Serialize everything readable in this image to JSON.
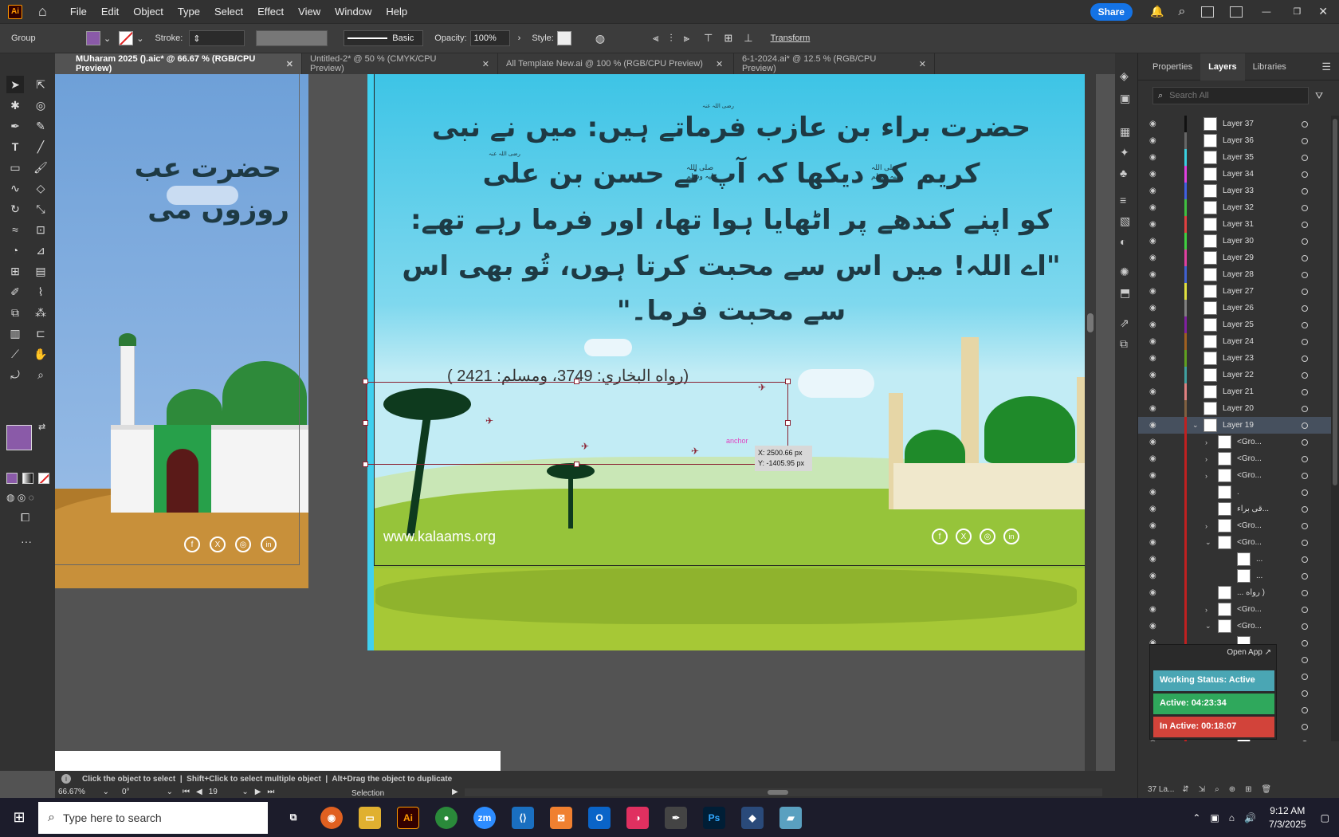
{
  "app": {
    "logo": "Ai",
    "home_icon": "home-icon"
  },
  "menu": [
    "File",
    "Edit",
    "Object",
    "Type",
    "Select",
    "Effect",
    "View",
    "Window",
    "Help"
  ],
  "topright": {
    "share": "Share"
  },
  "control": {
    "selection_label": "Group",
    "fill_color": "#8a5aa8",
    "stroke_label": "Stroke:",
    "brush_label": "Basic",
    "opacity_label": "Opacity:",
    "opacity_value": "100%",
    "style_label": "Style:",
    "transform_label": "Transform"
  },
  "tabs": [
    {
      "label": "MUharam 2025 ().aic* @ 66.67 % (RGB/CPU Preview)",
      "active": true
    },
    {
      "label": "Untitled-2* @ 50 % (CMYK/CPU Preview)",
      "active": false
    },
    {
      "label": "All Template New.ai @ 100 % (RGB/CPU Preview)",
      "active": false
    },
    {
      "label": "6-1-2024.ai* @ 12.5 % (RGB/CPU Preview)",
      "active": false
    }
  ],
  "artwork": {
    "left_lines": [
      "حضرت عب",
      "روزوں می"
    ],
    "main_lines": [
      "حضرت براء بن عازب فرماتے ہیں: میں نے نبی",
      "کریم کو دیکھا کہ آپ نے حسن بن علی",
      "کو اپنے کندھے پر اٹھایا ہوا تھا، اور فرما رہے تھے:",
      "\"اے اللہ! میں اس سے محبت کرتا ہوں، تُو بھی اس",
      "سے محبت فرما۔\""
    ],
    "honorific_1": "رضی اللہ عنہ",
    "honorific_2": "صلی اللہ علیہ وسلم",
    "reference": "(رواه البخاري: 3749، ومسلم: 2421 )",
    "website": "www.kalaams.org",
    "anchor_label": "anchor",
    "coord_x": "X: 2500.66 px",
    "coord_y": "Y: -1405.95 px",
    "social_icons": [
      "facebook-icon",
      "x-icon",
      "instagram-icon",
      "linkedin-icon"
    ]
  },
  "panel": {
    "tabs": [
      "Properties",
      "Layers",
      "Libraries"
    ],
    "active_tab": "Layers",
    "search_placeholder": "Search All",
    "layers": [
      {
        "name": "Layer 37",
        "color": "#111111"
      },
      {
        "name": "Layer 36",
        "color": "#666666"
      },
      {
        "name": "Layer 35",
        "color": "#3ad0e0"
      },
      {
        "name": "Layer 34",
        "color": "#e040e0"
      },
      {
        "name": "Layer 33",
        "color": "#4060e0"
      },
      {
        "name": "Layer 32",
        "color": "#40c040"
      },
      {
        "name": "Layer 31",
        "color": "#e04040"
      },
      {
        "name": "Layer 30",
        "color": "#40d040"
      },
      {
        "name": "Layer 29",
        "color": "#e040a0"
      },
      {
        "name": "Layer 28",
        "color": "#4060d0"
      },
      {
        "name": "Layer 27",
        "color": "#e0e040"
      },
      {
        "name": "Layer 26",
        "color": "#808080"
      },
      {
        "name": "Layer 25",
        "color": "#8020a0"
      },
      {
        "name": "Layer 24",
        "color": "#a06020"
      },
      {
        "name": "Layer 23",
        "color": "#60a020"
      },
      {
        "name": "Layer 22",
        "color": "#40a0a0"
      },
      {
        "name": "Layer 21",
        "color": "#e08080"
      },
      {
        "name": "Layer 20",
        "color": "#806040"
      },
      {
        "name": "Layer 19",
        "color": "#c02020"
      }
    ],
    "sublayers": [
      {
        "name": "<Gro...",
        "indent": 1,
        "chev": "›"
      },
      {
        "name": "<Gro...",
        "indent": 1,
        "chev": "›"
      },
      {
        "name": "<Gro...",
        "indent": 1,
        "chev": "›"
      },
      {
        "name": ".",
        "indent": 1,
        "chev": ""
      },
      {
        "name": "قی براء...",
        "indent": 1,
        "chev": ""
      },
      {
        "name": "<Gro...",
        "indent": 1,
        "chev": "›"
      },
      {
        "name": "<Gro...",
        "indent": 1,
        "chev": "⌄"
      },
      {
        "name": "...",
        "indent": 2,
        "chev": ""
      },
      {
        "name": "...",
        "indent": 2,
        "chev": ""
      },
      {
        "name": "... رواه )",
        "indent": 1,
        "chev": ""
      },
      {
        "name": "<Gro...",
        "indent": 1,
        "chev": "›"
      },
      {
        "name": "<Gro...",
        "indent": 1,
        "chev": "⌄"
      }
    ],
    "footer_count": "37 La...",
    "open_app": "Open App",
    "working_status": "Working Status: Active",
    "active_time": "Active: 04:23:34",
    "inactive_time": "In Active: 00:18:07"
  },
  "status": {
    "hint": "Click the object to select  |  Shift+Click to select multiple object  |  Alt+Drag the object to duplicate",
    "zoom": "66.67%",
    "angle": "0°",
    "artboard": "19",
    "tool": "Selection"
  },
  "taskbar": {
    "search_placeholder": "Type here to search",
    "time": "9:12 AM",
    "date": "7/3/2025"
  }
}
